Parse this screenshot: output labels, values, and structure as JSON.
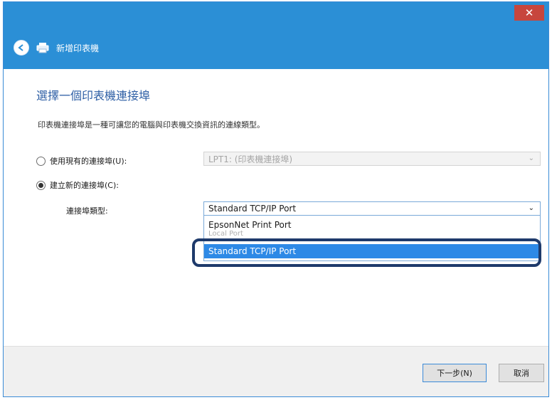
{
  "window": {
    "close_symbol": "✕"
  },
  "header": {
    "title": "新增印表機"
  },
  "main": {
    "heading": "選擇一個印表機連接埠",
    "description": "印表機連接埠是一種可讓您的電腦與印表機交換資訊的連線類型。",
    "use_existing": {
      "label": "使用現有的連接埠(U):",
      "checked": false,
      "value": "LPT1: (印表機連接埠)"
    },
    "create_new": {
      "label": "建立新的連接埠(C):",
      "checked": true
    },
    "port_type": {
      "label": "連接埠類型:",
      "value": "Standard TCP/IP Port",
      "options": [
        "EpsonNet Print Port",
        "Local Port",
        "Standard TCP/IP Port"
      ],
      "selected_index": 2
    }
  },
  "footer": {
    "next_label": "下一步(N)",
    "cancel_label": "取消"
  },
  "colors": {
    "accent": "#2b8fd6",
    "selection": "#2d89e6",
    "close": "#c7463d",
    "callout": "#1e3a6b"
  }
}
